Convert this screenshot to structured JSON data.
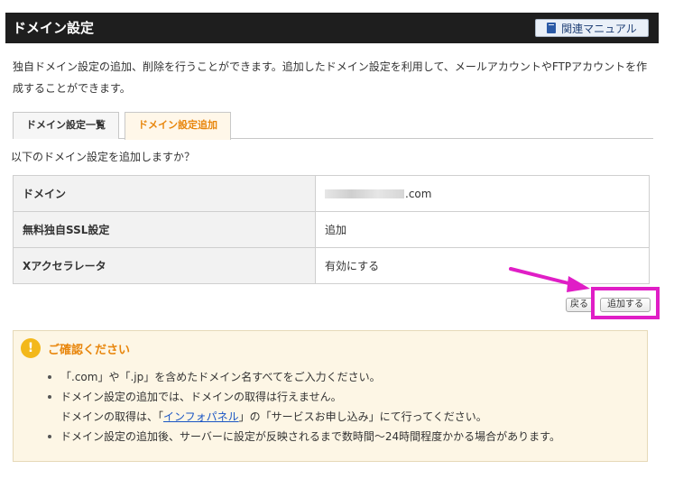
{
  "header": {
    "title": "ドメイン設定",
    "manual_button": "関連マニュアル"
  },
  "description": "独自ドメイン設定の追加、削除を行うことができます。追加したドメイン設定を利用して、メールアカウントやFTPアカウントを作成することができます。",
  "tabs": [
    {
      "label": "ドメイン設定一覧",
      "active": false
    },
    {
      "label": "ドメイン設定追加",
      "active": true
    }
  ],
  "question": "以下のドメイン設定を追加しますか？",
  "table": {
    "rows": [
      {
        "label": "ドメイン",
        "value": ".com"
      },
      {
        "label": "無料独自SSL設定",
        "value": "追加"
      },
      {
        "label": "Xアクセラレータ",
        "value": "有効にする"
      }
    ]
  },
  "buttons": {
    "back": "戻る",
    "add": "追加する"
  },
  "notice": {
    "icon": "!",
    "title": "ご確認ください",
    "item1": "「.com」や「.jp」を含めたドメイン名すべてをご入力ください。",
    "item2": "ドメイン設定の追加では、ドメインの取得は行えません。",
    "item3_prefix": "ドメインの取得は、「",
    "item3_link": "インフォパネル",
    "item3_suffix": "」の「サービスお申し込み」にて行ってください。",
    "item4": "ドメイン設定の追加後、サーバーに設定が反映されるまで数時間〜24時間程度かかる場合があります。"
  },
  "colors": {
    "accent_orange": "#e8860c",
    "highlight_magenta": "#e01ec6",
    "header_bg": "#1e1e1e",
    "link_blue": "#1a55c4"
  }
}
